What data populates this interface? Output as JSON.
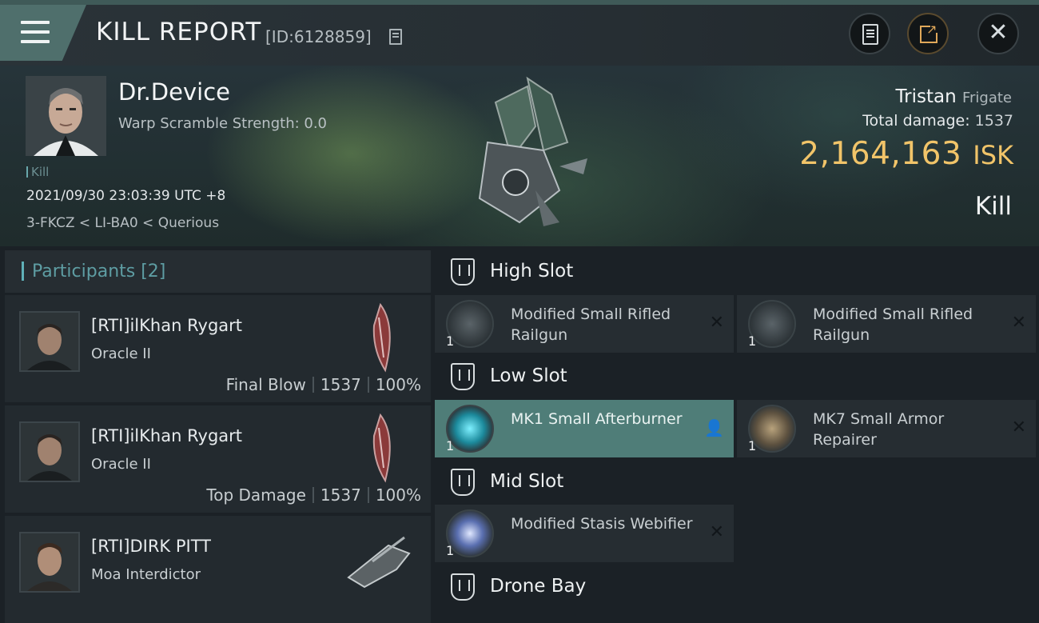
{
  "header": {
    "title": "KILL REPORT",
    "report_id": "[ID:6128859]"
  },
  "victim": {
    "name": "Dr.Device",
    "warp_scramble": "Warp Scramble Strength: 0.0",
    "tag": "Kill",
    "datetime": "2021/09/30 23:03:39 UTC +8",
    "location": "3-FKCZ < LI-BA0 < Querious",
    "ship_name": "Tristan",
    "ship_class": "Frigate",
    "total_damage_label": "Total damage:",
    "total_damage": "1537",
    "isk_value": "2,164,163",
    "isk_unit": "ISK",
    "result": "Kill"
  },
  "participants": {
    "title": "Participants [2]",
    "rows": [
      {
        "name": "[RTI]ilKhan Rygart",
        "ship": "Oracle II",
        "tag": "Final Blow",
        "damage": "1537",
        "percent": "100%"
      },
      {
        "name": "[RTI]ilKhan Rygart",
        "ship": "Oracle II",
        "tag": "Top Damage",
        "damage": "1537",
        "percent": "100%"
      },
      {
        "name": "[RTI]DIRK PITT",
        "ship": "Moa Interdictor"
      }
    ]
  },
  "fitting": {
    "high_slot": "High Slot",
    "low_slot": "Low Slot",
    "mid_slot": "Mid Slot",
    "drone_bay": "Drone Bay",
    "high": [
      {
        "name": "Modified Small Rifled Railgun",
        "qty": "1",
        "status": "destroyed"
      },
      {
        "name": "Modified Small Rifled Railgun",
        "qty": "1",
        "status": "destroyed"
      }
    ],
    "low": [
      {
        "name": "MK1 Small Afterburner",
        "qty": "1",
        "status": "dropped"
      },
      {
        "name": "MK7 Small Armor Repairer",
        "qty": "1",
        "status": "destroyed"
      }
    ],
    "mid": [
      {
        "name": "Modified Stasis Webifier",
        "qty": "1",
        "status": "destroyed"
      }
    ]
  },
  "icons": {
    "menu": "hamburger-icon",
    "copy": "copy-icon",
    "notes": "notes-icon",
    "share": "share-icon",
    "close": "close-icon",
    "destroyed": "x-icon",
    "dropped": "person-icon"
  },
  "colors": {
    "isk": "#f1c469",
    "accent": "#5fb1b8",
    "active_module": "#4f7d78"
  }
}
